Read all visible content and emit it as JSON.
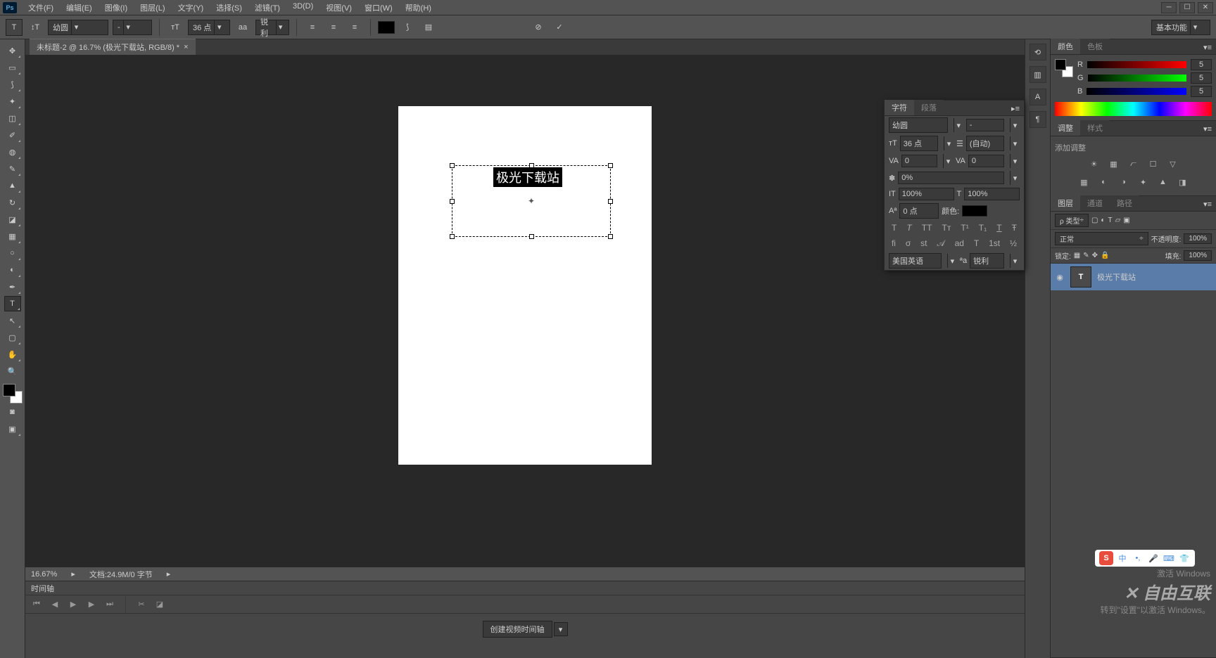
{
  "app": {
    "logo": "Ps"
  },
  "menu": [
    "文件(F)",
    "编辑(E)",
    "图像(I)",
    "图层(L)",
    "文字(Y)",
    "选择(S)",
    "滤镜(T)",
    "3D(D)",
    "视图(V)",
    "窗口(W)",
    "帮助(H)"
  ],
  "options": {
    "font_family": "幼圆",
    "font_style": "-",
    "font_size": "36 点",
    "aa_label": "aa",
    "antialias": "锐利",
    "workspace": "基本功能"
  },
  "doc": {
    "tab_title": "未标题-2 @ 16.7% (极光下载站, RGB/8) *",
    "canvas_text": "极光下载站"
  },
  "status": {
    "zoom": "16.67%",
    "doc_info": "文档:24.9M/0 字节"
  },
  "timeline": {
    "title": "时间轴",
    "create_btn": "创建视频时间轴"
  },
  "color_panel": {
    "tabs": [
      "颜色",
      "色板"
    ],
    "r_label": "R",
    "g_label": "G",
    "b_label": "B",
    "r": "5",
    "g": "5",
    "b": "5"
  },
  "adjust_panel": {
    "tabs": [
      "调整",
      "样式"
    ],
    "hint": "添加调整"
  },
  "layers_panel": {
    "tabs": [
      "图层",
      "通道",
      "路径"
    ],
    "kind": "ρ 类型",
    "blend": "正常",
    "opacity_label": "不透明度:",
    "opacity": "100%",
    "lock_label": "锁定:",
    "fill_label": "填充:",
    "fill": "100%",
    "layer_name": "极光下载站",
    "layer_thumb": "T"
  },
  "char_panel": {
    "tabs": [
      "字符",
      "段落"
    ],
    "font": "幼圆",
    "style": "-",
    "size": "36 点",
    "leading": "(自动)",
    "tracking": "0",
    "kerning": "0",
    "opt_pct": "0%",
    "vscale": "100%",
    "hscale": "100%",
    "baseline": "0 点",
    "color_label": "颜色:",
    "lang": "美国英语",
    "aa": "锐利"
  },
  "watermark": {
    "line1": "激活 Windows",
    "line2": "转到\"设置\"以激活 Windows。",
    "brand": "自由互联"
  },
  "ime": {
    "mode": "中"
  }
}
